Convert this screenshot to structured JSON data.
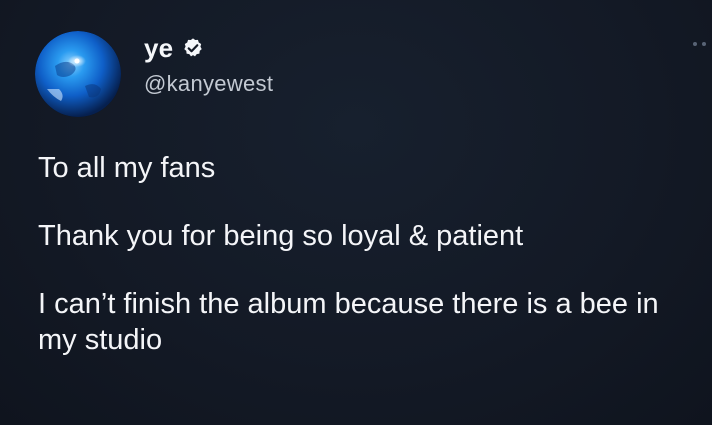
{
  "tweet": {
    "author": {
      "display_name": "ye",
      "handle": "@kanyewest",
      "verified_icon": "verified-badge-icon",
      "avatar_icon": "blue-sphere-avatar"
    },
    "paragraphs": [
      "To all my fans",
      "Thank you for being so loyal & patient",
      "I can’t finish the album because there is a bee in my studio"
    ],
    "more_icon": "more-options-icon"
  },
  "colors": {
    "background": "#141a26",
    "text": "#f4f5f8",
    "handle": "#c3c9d2",
    "avatar_blue": "#1f7de0"
  }
}
